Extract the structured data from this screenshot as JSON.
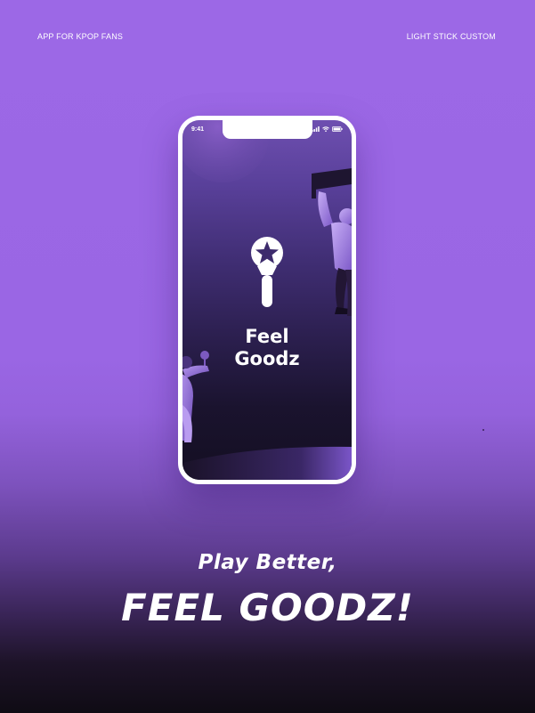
{
  "header": {
    "left_label": "APP FOR KPOP FANS",
    "right_label": "LIGHT STICK CUSTOM"
  },
  "phone": {
    "status_time": "9:41",
    "status_icons": [
      "signal-icon",
      "wifi-icon",
      "battery-icon"
    ],
    "app_name_line1": "Feel",
    "app_name_line2": "Goodz",
    "logo_icon": "light-stick-star-icon"
  },
  "hero": {
    "tagline": "Play Better,",
    "headline": "FEEL GOODZ!"
  },
  "colors": {
    "background_top": "#9c68e6",
    "background_bottom": "#0f0b14",
    "screen_top": "#6e4fb0",
    "screen_bottom": "#140f22",
    "accent_light": "#b89cf0",
    "text": "#ffffff"
  }
}
